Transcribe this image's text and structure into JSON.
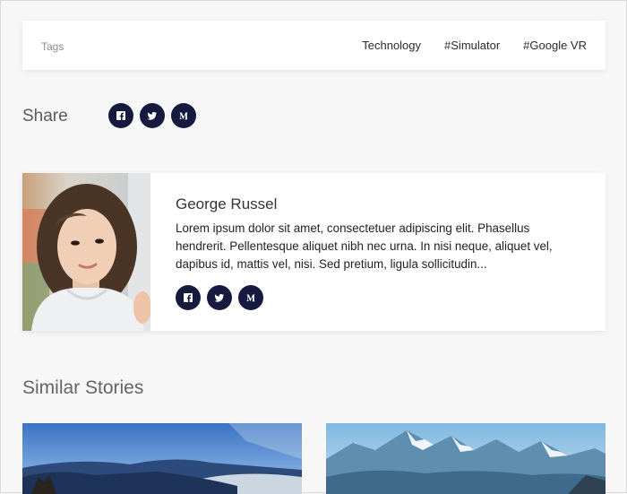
{
  "tags": {
    "label": "Tags",
    "items": [
      "Technology",
      "#Simulator",
      "#Google VR"
    ]
  },
  "share": {
    "label": "Share",
    "icons": [
      "facebook-icon",
      "twitter-icon",
      "medium-icon"
    ]
  },
  "author": {
    "name": "George Russel",
    "bio": "Lorem ipsum dolor sit amet, consectetuer adipiscing elit. Phasellus hendrerit. Pellentesque aliquet nibh nec urna. In nisi neque, aliquet vel, dapibus id, mattis vel, nisi. Sed pretium, ligula sollicitudin...",
    "icons": [
      "facebook-icon",
      "twitter-icon",
      "medium-icon"
    ]
  },
  "similar": {
    "heading": "Similar Stories"
  },
  "colors": {
    "accent": "#161a3f",
    "background": "#f7f7f8",
    "card": "#ffffff"
  }
}
